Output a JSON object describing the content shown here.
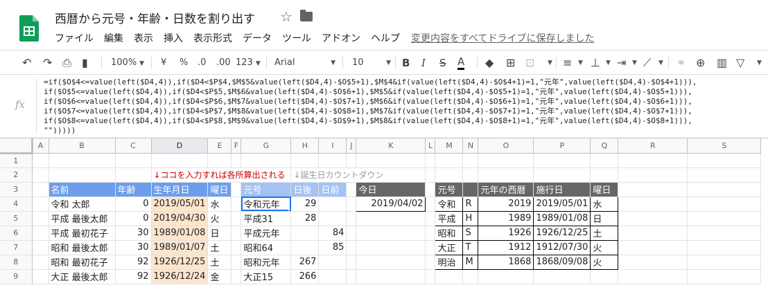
{
  "title": "西暦から元号・年齢・日数を割り出す",
  "menu": [
    "ファイル",
    "編集",
    "表示",
    "挿入",
    "表示形式",
    "データ",
    "ツール",
    "アドオン",
    "ヘルプ"
  ],
  "save_status": "変更内容をすべてドライブに保存しました",
  "toolbar": {
    "zoom": "100%",
    "currency": "¥",
    "percent": "%",
    "dec_less": ".0",
    "dec_more": ".00",
    "format": "123",
    "font": "Arial",
    "font_size": "10",
    "bold": "B",
    "italic": "I",
    "strike": "S",
    "text_color": "A"
  },
  "formula_lines": [
    "=if($O$4<=value(left($D4,4)),if($D4<$P$4,$M$5&value(left($D4,4)-$O$5+1),$M$4&if(value(left($D4,4)-$O$4+1)=1,\"元年\",value(left($D4,4)-$O$4+1))),",
    "if($O$5<=value(left($D4,4)),if($D4<$P$5,$M$6&value(left($D4,4)-$O$6+1),$M$5&if(value(left($D4,4)-$O$5+1)=1,\"元年\",value(left($D4,4)-$O$5+1))),",
    "if($O$6<=value(left($D4,4)),if($D4<$P$6,$M$7&value(left($D4,4)-$O$7+1),$M$6&if(value(left($D4,4)-$O$6+1)=1,\"元年\",value(left($D4,4)-$O$6+1))),",
    "if($O$7<=value(left($D4,4)),if($D4<$P$7,$M$8&value(left($D4,4)-$O$8+1),$M$7&if(value(left($D4,4)-$O$7+1)=1,\"元年\",value(left($D4,4)-$O$7+1))),",
    "if($O$8<=value(left($D4,4)),if($D4<$P$8,$M$9&value(left($D4,4)-$O$9+1),$M$8&if(value(left($D4,4)-$O$8+1)=1,\"元年\",value(left($D4,4)-$O$8+1))),",
    "\"\")))))"
  ],
  "columns": [
    "A",
    "B",
    "C",
    "D",
    "E",
    "F",
    "G",
    "H",
    "I",
    "J",
    "K",
    "L",
    "M",
    "N",
    "O",
    "P",
    "Q",
    "R",
    "S"
  ],
  "rows": [
    "1",
    "2",
    "3",
    "4",
    "5",
    "6",
    "7",
    "8",
    "9"
  ],
  "notes": {
    "input_note": "↓ココを入力すれば各所算出される",
    "countdown_note": "↓誕生日カウントダウン"
  },
  "people_headers": [
    "名前",
    "年齢",
    "生年月日",
    "曜日"
  ],
  "people": [
    [
      "令和 太郎",
      "0",
      "2019/05/01",
      "水"
    ],
    [
      "平成 最後太郎",
      "0",
      "2019/04/30",
      "火"
    ],
    [
      "平成 最初花子",
      "30",
      "1989/01/08",
      "日"
    ],
    [
      "昭和 最後太郎",
      "30",
      "1989/01/07",
      "土"
    ],
    [
      "昭和 最初花子",
      "92",
      "1926/12/25",
      "土"
    ],
    [
      "大正 最後太郎",
      "92",
      "1926/12/24",
      "金"
    ]
  ],
  "era_calc_headers": [
    "元号",
    "日後",
    "日前"
  ],
  "era_calc": [
    [
      "令和元年",
      "29",
      ""
    ],
    [
      "平成31",
      "28",
      ""
    ],
    [
      "平成元年",
      "",
      "84"
    ],
    [
      "昭和64",
      "",
      "85"
    ],
    [
      "昭和元年",
      "267",
      ""
    ],
    [
      "大正15",
      "266",
      ""
    ]
  ],
  "today_header": "今日",
  "today_value": "2019/04/02",
  "era_table_headers": [
    "元号",
    "",
    "元年の西暦",
    "施行日",
    "曜日"
  ],
  "era_table": [
    [
      "令和",
      "R",
      "2019",
      "2019/05/01",
      "水"
    ],
    [
      "平成",
      "H",
      "1989",
      "1989/01/08",
      "日"
    ],
    [
      "昭和",
      "S",
      "1926",
      "1926/12/25",
      "土"
    ],
    [
      "大正",
      "T",
      "1912",
      "1912/07/30",
      "火"
    ],
    [
      "明治",
      "M",
      "1868",
      "1868/09/08",
      "火"
    ]
  ],
  "colors": {
    "header_blue": "#6d9eeb",
    "header_light_blue": "#a4c2f4",
    "header_gray": "#666666",
    "date_fill": "#fce5cd",
    "note_red": "#cc0000",
    "selection": "#1a73e8",
    "logo_green": "#0f9d58"
  }
}
